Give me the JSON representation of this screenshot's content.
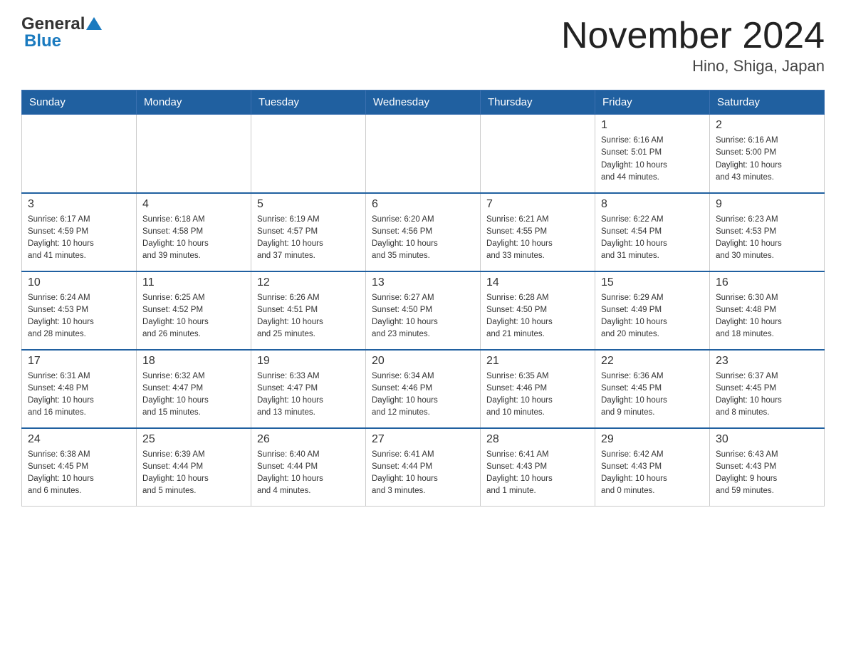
{
  "header": {
    "logo_general": "General",
    "logo_blue": "Blue",
    "month_year": "November 2024",
    "location": "Hino, Shiga, Japan"
  },
  "weekdays": [
    "Sunday",
    "Monday",
    "Tuesday",
    "Wednesday",
    "Thursday",
    "Friday",
    "Saturday"
  ],
  "weeks": [
    [
      {
        "day": "",
        "info": ""
      },
      {
        "day": "",
        "info": ""
      },
      {
        "day": "",
        "info": ""
      },
      {
        "day": "",
        "info": ""
      },
      {
        "day": "",
        "info": ""
      },
      {
        "day": "1",
        "info": "Sunrise: 6:16 AM\nSunset: 5:01 PM\nDaylight: 10 hours\nand 44 minutes."
      },
      {
        "day": "2",
        "info": "Sunrise: 6:16 AM\nSunset: 5:00 PM\nDaylight: 10 hours\nand 43 minutes."
      }
    ],
    [
      {
        "day": "3",
        "info": "Sunrise: 6:17 AM\nSunset: 4:59 PM\nDaylight: 10 hours\nand 41 minutes."
      },
      {
        "day": "4",
        "info": "Sunrise: 6:18 AM\nSunset: 4:58 PM\nDaylight: 10 hours\nand 39 minutes."
      },
      {
        "day": "5",
        "info": "Sunrise: 6:19 AM\nSunset: 4:57 PM\nDaylight: 10 hours\nand 37 minutes."
      },
      {
        "day": "6",
        "info": "Sunrise: 6:20 AM\nSunset: 4:56 PM\nDaylight: 10 hours\nand 35 minutes."
      },
      {
        "day": "7",
        "info": "Sunrise: 6:21 AM\nSunset: 4:55 PM\nDaylight: 10 hours\nand 33 minutes."
      },
      {
        "day": "8",
        "info": "Sunrise: 6:22 AM\nSunset: 4:54 PM\nDaylight: 10 hours\nand 31 minutes."
      },
      {
        "day": "9",
        "info": "Sunrise: 6:23 AM\nSunset: 4:53 PM\nDaylight: 10 hours\nand 30 minutes."
      }
    ],
    [
      {
        "day": "10",
        "info": "Sunrise: 6:24 AM\nSunset: 4:53 PM\nDaylight: 10 hours\nand 28 minutes."
      },
      {
        "day": "11",
        "info": "Sunrise: 6:25 AM\nSunset: 4:52 PM\nDaylight: 10 hours\nand 26 minutes."
      },
      {
        "day": "12",
        "info": "Sunrise: 6:26 AM\nSunset: 4:51 PM\nDaylight: 10 hours\nand 25 minutes."
      },
      {
        "day": "13",
        "info": "Sunrise: 6:27 AM\nSunset: 4:50 PM\nDaylight: 10 hours\nand 23 minutes."
      },
      {
        "day": "14",
        "info": "Sunrise: 6:28 AM\nSunset: 4:50 PM\nDaylight: 10 hours\nand 21 minutes."
      },
      {
        "day": "15",
        "info": "Sunrise: 6:29 AM\nSunset: 4:49 PM\nDaylight: 10 hours\nand 20 minutes."
      },
      {
        "day": "16",
        "info": "Sunrise: 6:30 AM\nSunset: 4:48 PM\nDaylight: 10 hours\nand 18 minutes."
      }
    ],
    [
      {
        "day": "17",
        "info": "Sunrise: 6:31 AM\nSunset: 4:48 PM\nDaylight: 10 hours\nand 16 minutes."
      },
      {
        "day": "18",
        "info": "Sunrise: 6:32 AM\nSunset: 4:47 PM\nDaylight: 10 hours\nand 15 minutes."
      },
      {
        "day": "19",
        "info": "Sunrise: 6:33 AM\nSunset: 4:47 PM\nDaylight: 10 hours\nand 13 minutes."
      },
      {
        "day": "20",
        "info": "Sunrise: 6:34 AM\nSunset: 4:46 PM\nDaylight: 10 hours\nand 12 minutes."
      },
      {
        "day": "21",
        "info": "Sunrise: 6:35 AM\nSunset: 4:46 PM\nDaylight: 10 hours\nand 10 minutes."
      },
      {
        "day": "22",
        "info": "Sunrise: 6:36 AM\nSunset: 4:45 PM\nDaylight: 10 hours\nand 9 minutes."
      },
      {
        "day": "23",
        "info": "Sunrise: 6:37 AM\nSunset: 4:45 PM\nDaylight: 10 hours\nand 8 minutes."
      }
    ],
    [
      {
        "day": "24",
        "info": "Sunrise: 6:38 AM\nSunset: 4:45 PM\nDaylight: 10 hours\nand 6 minutes."
      },
      {
        "day": "25",
        "info": "Sunrise: 6:39 AM\nSunset: 4:44 PM\nDaylight: 10 hours\nand 5 minutes."
      },
      {
        "day": "26",
        "info": "Sunrise: 6:40 AM\nSunset: 4:44 PM\nDaylight: 10 hours\nand 4 minutes."
      },
      {
        "day": "27",
        "info": "Sunrise: 6:41 AM\nSunset: 4:44 PM\nDaylight: 10 hours\nand 3 minutes."
      },
      {
        "day": "28",
        "info": "Sunrise: 6:41 AM\nSunset: 4:43 PM\nDaylight: 10 hours\nand 1 minute."
      },
      {
        "day": "29",
        "info": "Sunrise: 6:42 AM\nSunset: 4:43 PM\nDaylight: 10 hours\nand 0 minutes."
      },
      {
        "day": "30",
        "info": "Sunrise: 6:43 AM\nSunset: 4:43 PM\nDaylight: 9 hours\nand 59 minutes."
      }
    ]
  ]
}
